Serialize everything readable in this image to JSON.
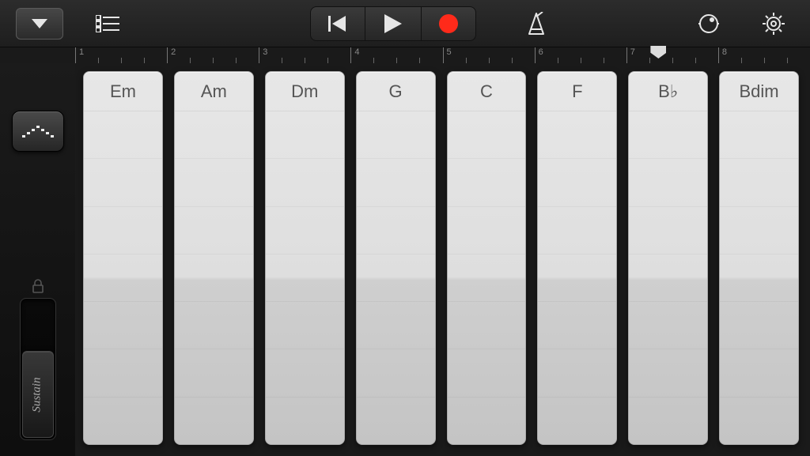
{
  "toolbar": {
    "dropdown_icon": "instrument-dropdown",
    "tracks_icon": "tracks-view",
    "rewind_icon": "rewind",
    "play_icon": "play",
    "record_icon": "record",
    "metronome_icon": "metronome",
    "master_icon": "master-fx",
    "settings_icon": "settings"
  },
  "ruler": {
    "bars": [
      "1",
      "2",
      "3",
      "4",
      "5",
      "6",
      "7",
      "8"
    ],
    "playhead_bar_index": 6
  },
  "sidebar": {
    "arpeggiator_icon": "arpeggiator",
    "lock_icon": "lock",
    "sustain_label": "Sustain"
  },
  "chords": [
    {
      "label": "Em"
    },
    {
      "label": "Am"
    },
    {
      "label": "Dm"
    },
    {
      "label": "G"
    },
    {
      "label": "C"
    },
    {
      "label": "F"
    },
    {
      "label": "B♭"
    },
    {
      "label": "Bdim"
    }
  ],
  "colors": {
    "record": "#ff2a1a",
    "background": "#1a1a1a",
    "chord_face": "#e4e4e4"
  }
}
